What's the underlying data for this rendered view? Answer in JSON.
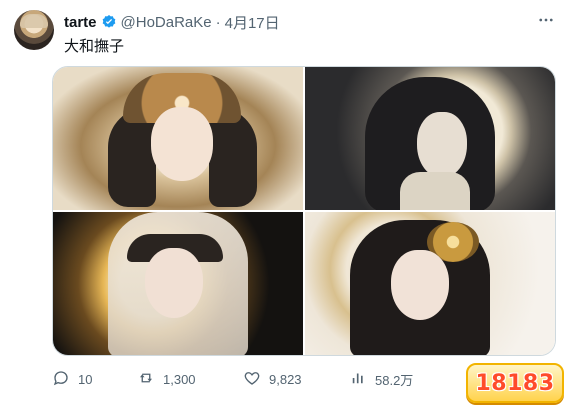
{
  "post": {
    "author_name": "tarte",
    "handle": "@HoDaRaKe",
    "separator": "·",
    "date": "4月17日",
    "text": "大和撫子",
    "verified_icon": "verified-badge-icon",
    "more_icon": "more-options-icon"
  },
  "images": [
    {
      "name": "image-1"
    },
    {
      "name": "image-2"
    },
    {
      "name": "image-3"
    },
    {
      "name": "image-4"
    }
  ],
  "actions": {
    "reply_count": "10",
    "repost_count": "1,300",
    "like_count": "9,823",
    "views_count": "58.2万"
  },
  "watermark": {
    "text": "18183"
  },
  "colors": {
    "verified": "#1d9bf0",
    "secondary_text": "#536471",
    "border": "#cfd9de"
  }
}
